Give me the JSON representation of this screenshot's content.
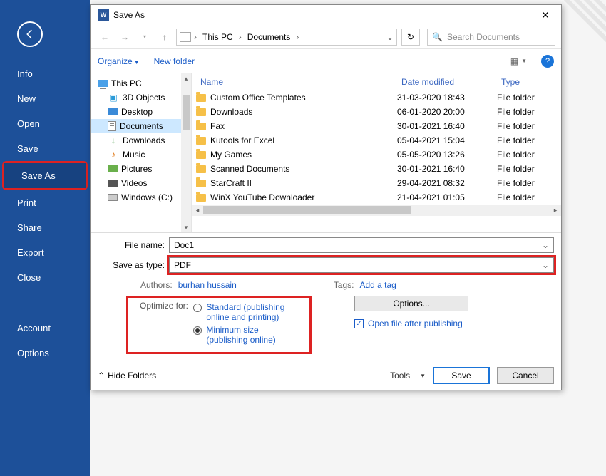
{
  "leftmenu": {
    "items": [
      "Info",
      "New",
      "Open",
      "Save",
      "Save As",
      "Print",
      "Share",
      "Export",
      "Close"
    ],
    "bottom": [
      "Account",
      "Options"
    ],
    "selected": "Save As"
  },
  "dialog": {
    "title": "Save As",
    "breadcrumbs": [
      "This PC",
      "Documents"
    ],
    "search_placeholder": "Search Documents",
    "toolbar": {
      "organize": "Organize",
      "newfolder": "New folder"
    },
    "tree": [
      {
        "label": "This PC",
        "icon": "pc",
        "level": 0,
        "sel": false
      },
      {
        "label": "3D Objects",
        "icon": "cube",
        "level": 1,
        "sel": false
      },
      {
        "label": "Desktop",
        "icon": "desk",
        "level": 1,
        "sel": false
      },
      {
        "label": "Documents",
        "icon": "doc",
        "level": 1,
        "sel": true
      },
      {
        "label": "Downloads",
        "icon": "dl",
        "level": 1,
        "sel": false
      },
      {
        "label": "Music",
        "icon": "mus",
        "level": 1,
        "sel": false
      },
      {
        "label": "Pictures",
        "icon": "pic",
        "level": 1,
        "sel": false
      },
      {
        "label": "Videos",
        "icon": "vid",
        "level": 1,
        "sel": false
      },
      {
        "label": "Windows (C:)",
        "icon": "drv",
        "level": 1,
        "sel": false
      }
    ],
    "columns": {
      "name": "Name",
      "date": "Date modified",
      "type": "Type"
    },
    "files": [
      {
        "name": "Custom Office Templates",
        "date": "31-03-2020 18:43",
        "type": "File folder"
      },
      {
        "name": "Downloads",
        "date": "06-01-2020 20:00",
        "type": "File folder"
      },
      {
        "name": "Fax",
        "date": "30-01-2021 16:40",
        "type": "File folder"
      },
      {
        "name": "Kutools for Excel",
        "date": "05-04-2021 15:04",
        "type": "File folder"
      },
      {
        "name": "My Games",
        "date": "05-05-2020 13:26",
        "type": "File folder"
      },
      {
        "name": "Scanned Documents",
        "date": "30-01-2021 16:40",
        "type": "File folder"
      },
      {
        "name": "StarCraft II",
        "date": "29-04-2021 08:32",
        "type": "File folder"
      },
      {
        "name": "WinX YouTube Downloader",
        "date": "21-04-2021 01:05",
        "type": "File folder"
      }
    ],
    "filename_label": "File name:",
    "filename_value": "Doc1",
    "saveastype_label": "Save as type:",
    "saveastype_value": "PDF",
    "authors_label": "Authors:",
    "authors_value": "burhan hussain",
    "tags_label": "Tags:",
    "tags_value": "Add a tag",
    "optimize_label": "Optimize for:",
    "optimize_opts": {
      "standard": "Standard (publishing online and printing)",
      "minimum": "Minimum size (publishing online)",
      "selected": "minimum"
    },
    "options_button": "Options...",
    "open_after": "Open file after publishing",
    "open_after_checked": true,
    "hide_folders": "Hide Folders",
    "tools": "Tools",
    "save": "Save",
    "cancel": "Cancel"
  }
}
